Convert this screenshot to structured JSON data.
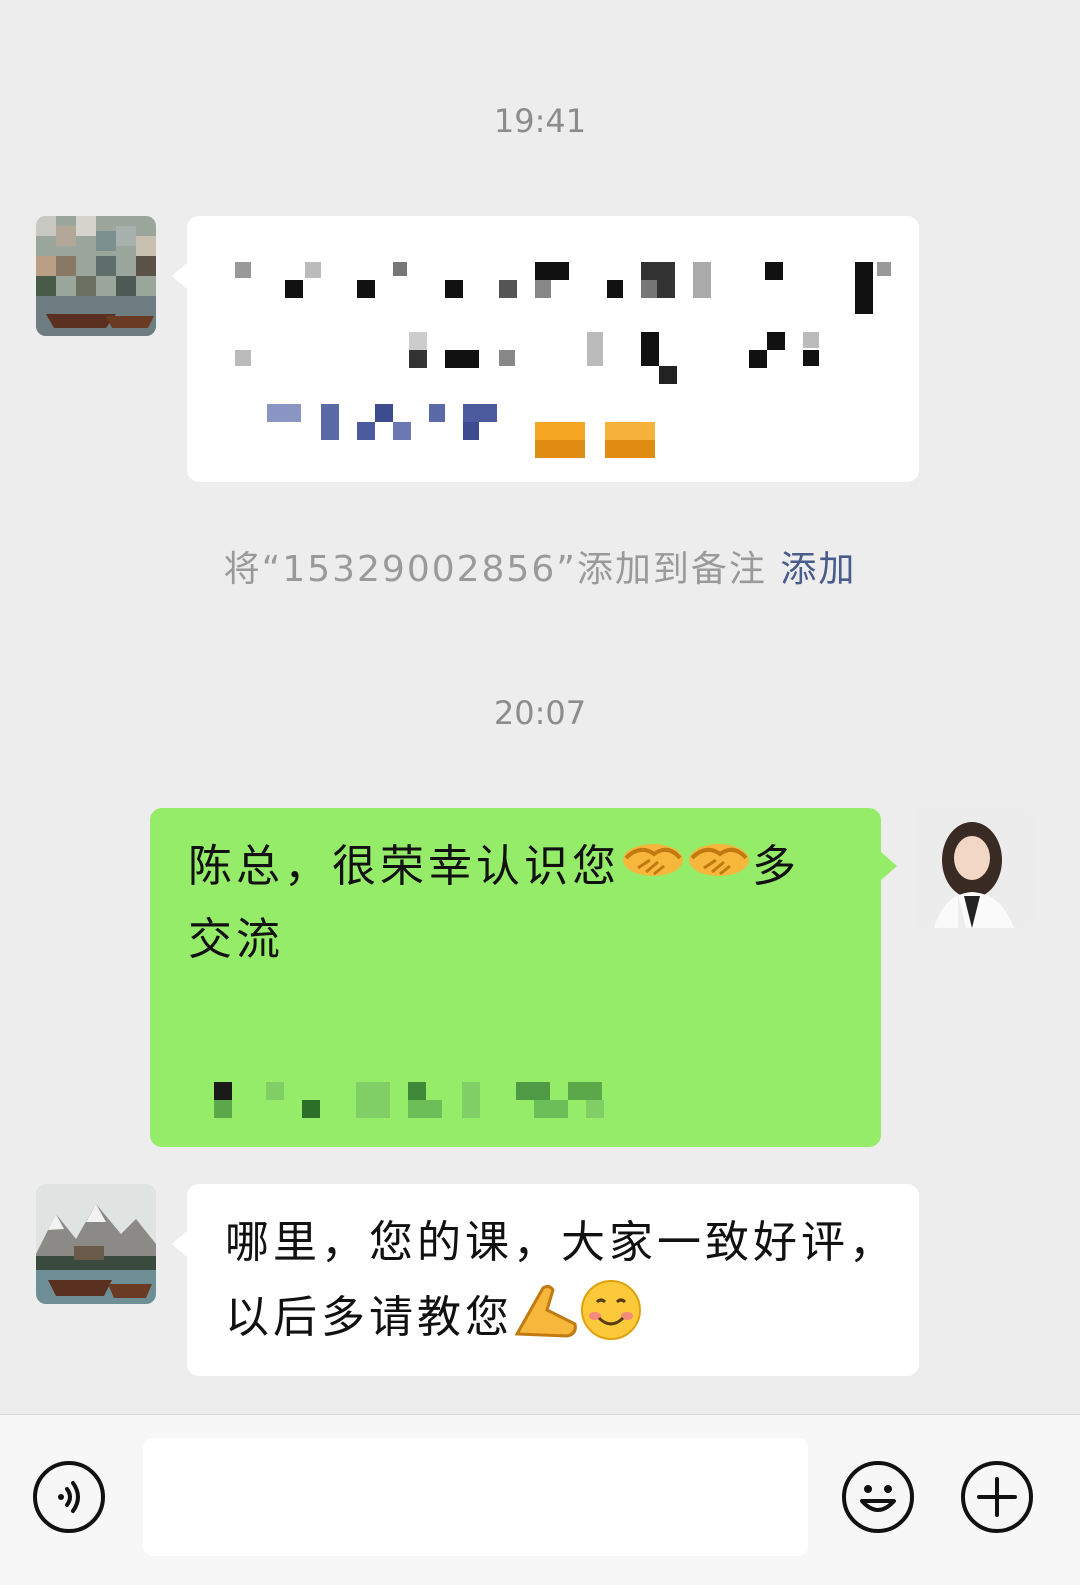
{
  "messages": {
    "time1": "19:41",
    "time2": "20:07",
    "system_prefix": "将“15329002856”添加到备注",
    "system_link": "添加",
    "sent_line1": "陈总，很荣幸认识您",
    "sent_line1_tail": "多",
    "sent_line2": "交流",
    "received2_line1": "哪里，您的课，大家一致好评，",
    "received2_line2": "以后多请教您"
  },
  "icons": {
    "voice": "voice-icon",
    "emoji": "emoji-icon",
    "plus": "plus-icon",
    "handshake": "handshake-emoji",
    "pray": "pray-emoji",
    "smile": "smile-emoji"
  },
  "colors": {
    "background": "#ededed",
    "bubble_sent": "#95ec69",
    "bubble_received": "#ffffff",
    "link": "#4a5c8c"
  }
}
